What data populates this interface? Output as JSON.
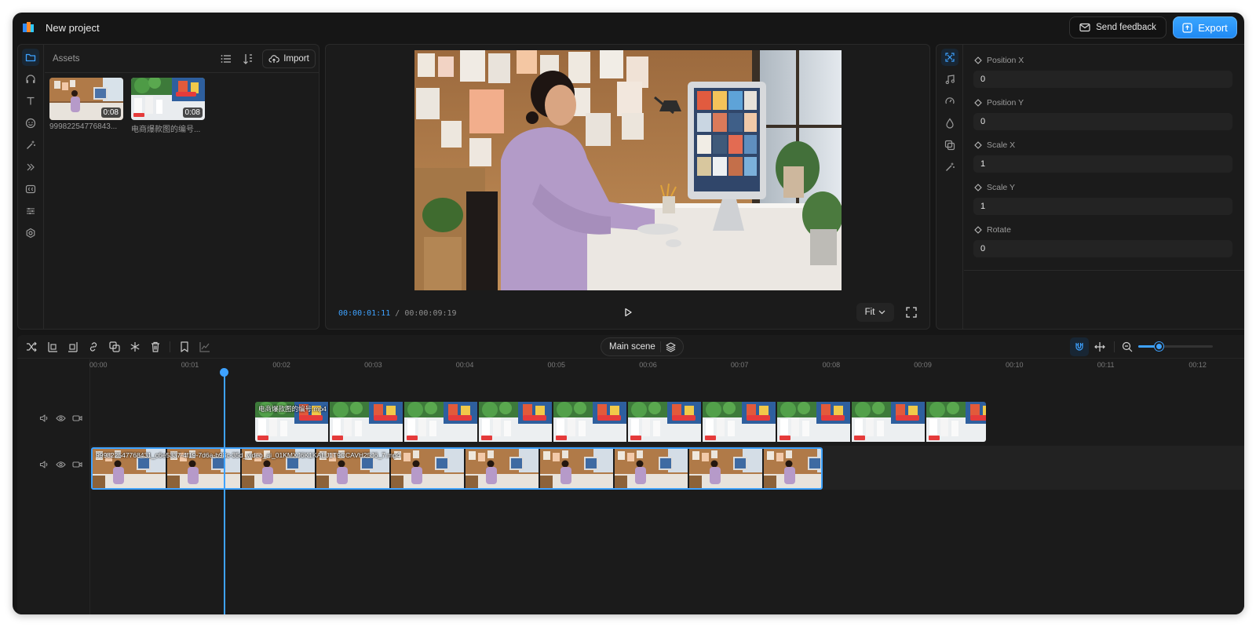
{
  "project": {
    "title": "New project"
  },
  "header": {
    "feedback_label": "Send feedback",
    "export_label": "Export"
  },
  "left_rail": {
    "icons": [
      "folder-icon",
      "headphones-icon",
      "text-icon",
      "sticker-icon",
      "magic-icon",
      "transition-icon",
      "caption-icon",
      "adjust-icon",
      "settings-icon"
    ],
    "active": "folder-icon"
  },
  "assets": {
    "label": "Assets",
    "import_label": "Import",
    "items": [
      {
        "name": "99982254776843...",
        "duration": "0:08"
      },
      {
        "name": "电商爆款图的编号...",
        "duration": "0:08"
      }
    ]
  },
  "preview": {
    "current_time": "00:00:01:11",
    "separator": "/",
    "total_time": "00:00:09:19",
    "fit_label": "Fit"
  },
  "properties": {
    "fields": [
      {
        "label": "Position X",
        "value": "0"
      },
      {
        "label": "Position Y",
        "value": "0"
      },
      {
        "label": "Scale X",
        "value": "1"
      },
      {
        "label": "Scale Y",
        "value": "1"
      },
      {
        "label": "Rotate",
        "value": "0"
      }
    ]
  },
  "timeline": {
    "scene_label": "Main scene",
    "ruler_ticks": [
      "00:00",
      "00:01",
      "00:02",
      "00:03",
      "00:04",
      "00:05",
      "00:06",
      "00:07",
      "00:08",
      "00:09",
      "00:10",
      "00:11",
      "00:12"
    ],
    "zoom_level": 0.27,
    "tracks": [
      {
        "clip_label": "电商爆款图的编号.mp4"
      },
      {
        "clip_label": "999822547768431_c6e5337-4f19-7d6a-b98c-35d_video_ai_01KMXJ6K1KAEJ1T9CCAVH25J6_7.mp4"
      }
    ]
  },
  "colors": {
    "accent": "#3ea2ff",
    "bg": "#161616",
    "panel": "#1b1b1b"
  }
}
